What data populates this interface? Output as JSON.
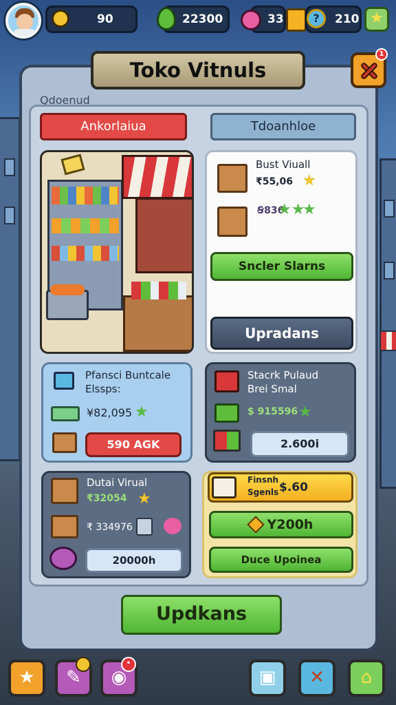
{
  "hud": {
    "gold_coin_value": "90",
    "gem_value": "22300",
    "donut_value": "33",
    "coin_value": "210",
    "coin_symbol": "?"
  },
  "title": "Toko Vitnuls",
  "subtitle": "Qdoenud",
  "tabs": [
    {
      "label": "Ankorlaiua",
      "color": "#e34a47"
    },
    {
      "label": "Tdoanhloe",
      "color": "#8fb2cf"
    }
  ],
  "side_panel": {
    "item1_name": "Bust Viuall",
    "item1_price": "₹55,06",
    "item2_price": "Ꞩ836",
    "stars_button": "Sncler Slarns",
    "upgrade_button": "Upradans"
  },
  "card_a": {
    "title": "Pfansci Buntcale",
    "subtitle": "Elssps:",
    "price": "¥82,095",
    "button": "590 AGK"
  },
  "card_b": {
    "title": "Stacrk Pulaud",
    "subtitle": "Brei Smal",
    "price": "$ 915596",
    "button": "2.600i"
  },
  "card_c": {
    "title": "Dutai Virual",
    "price1": "₹32054",
    "price2": "₹ 334976",
    "button": "20000h"
  },
  "card_d": {
    "title_line1": "Finsnh",
    "title_line2": "Sgenls",
    "price": "$.60",
    "button1": "Y200h",
    "button2": "Duce Upoinea"
  },
  "main_button": "Updkans",
  "colors": {
    "accent_green": "#5ec23f",
    "accent_red": "#e34a47",
    "panel": "#aebfd4"
  }
}
